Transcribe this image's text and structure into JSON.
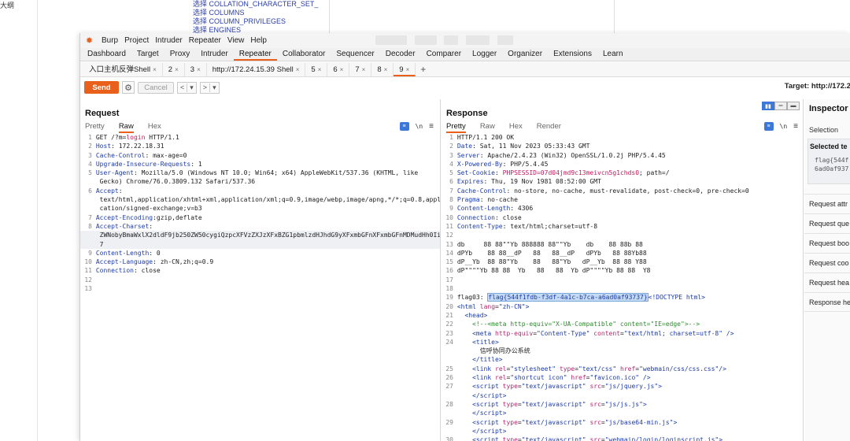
{
  "background": {
    "left_text": "大纲",
    "db_list": [
      "选择 COLLATION_CHARACTER_SET_",
      "选择 COLUMNS",
      "选择 COLUMN_PRIVILEGES",
      "选择 ENGINES"
    ]
  },
  "menu": {
    "logo_glyph": "✹",
    "items": [
      "Burp",
      "Project",
      "Intruder",
      "Repeater",
      "View",
      "Help"
    ]
  },
  "main_tabs": {
    "active": "Repeater",
    "items": [
      "Dashboard",
      "Target",
      "Proxy",
      "Intruder",
      "Repeater",
      "Collaborator",
      "Sequencer",
      "Decoder",
      "Comparer",
      "Logger",
      "Organizer",
      "Extensions",
      "Learn"
    ]
  },
  "repeater_tabs": {
    "close_glyph": "×",
    "add_glyph": "+",
    "active": "9",
    "items": [
      "入口主机反弹Shell",
      "2",
      "3",
      "http://172.24.15.39 Shell",
      "5",
      "6",
      "7",
      "8",
      "9"
    ]
  },
  "toolbar": {
    "send_label": "Send",
    "cancel_label": "Cancel",
    "gear_glyph": "⚙",
    "back_glyph": "<",
    "forward_glyph": ">",
    "dropdown_glyph": "▾",
    "target_label": "Target: http://172.2"
  },
  "request": {
    "title": "Request",
    "subtabs": [
      "Pretty",
      "Raw",
      "Hex"
    ],
    "active_subtab": "Raw",
    "ln_label": "\\n",
    "menu_glyph": "≡"
  },
  "response": {
    "title": "Response",
    "subtabs": [
      "Pretty",
      "Raw",
      "Hex",
      "Render"
    ],
    "active_subtab": "Pretty",
    "ln_label": "\\n",
    "menu_glyph": "≡"
  },
  "inspector": {
    "title": "Inspector",
    "selection_label": "Selection",
    "selected_text_title": "Selected te",
    "selected_text_value": "flag{544f\n6ad0af937",
    "rows": [
      "Request attr",
      "Request que",
      "Request boo",
      "Request coo",
      "Request hea",
      "Response he"
    ]
  }
}
